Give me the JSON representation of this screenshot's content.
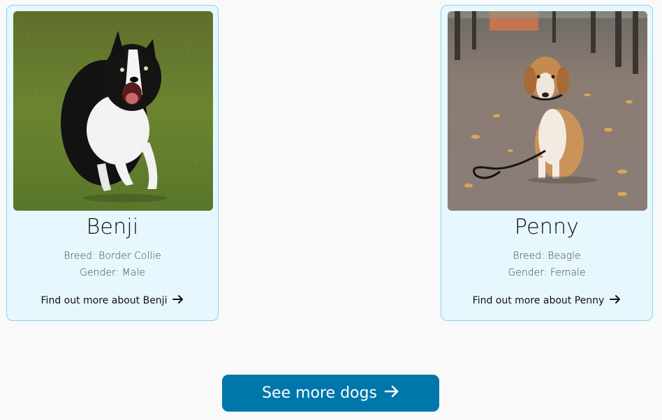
{
  "dogs": [
    {
      "name": "Benji",
      "breed_line": "Breed: Border Collie",
      "gender_line": "Gender: Male",
      "link_label": "Find out more about Benji"
    },
    {
      "name": "Penny",
      "breed_line": "Breed: Beagle",
      "gender_line": "Gender: Female",
      "link_label": "Find out more about Penny"
    }
  ],
  "see_more": {
    "label": "See more dogs",
    "icon": "arrow-right-icon"
  },
  "colors": {
    "card_bg": "#e6f7fd",
    "card_border": "#7fd6ee",
    "button_bg": "#0077aa",
    "page_bg": "#f9f9fa"
  }
}
